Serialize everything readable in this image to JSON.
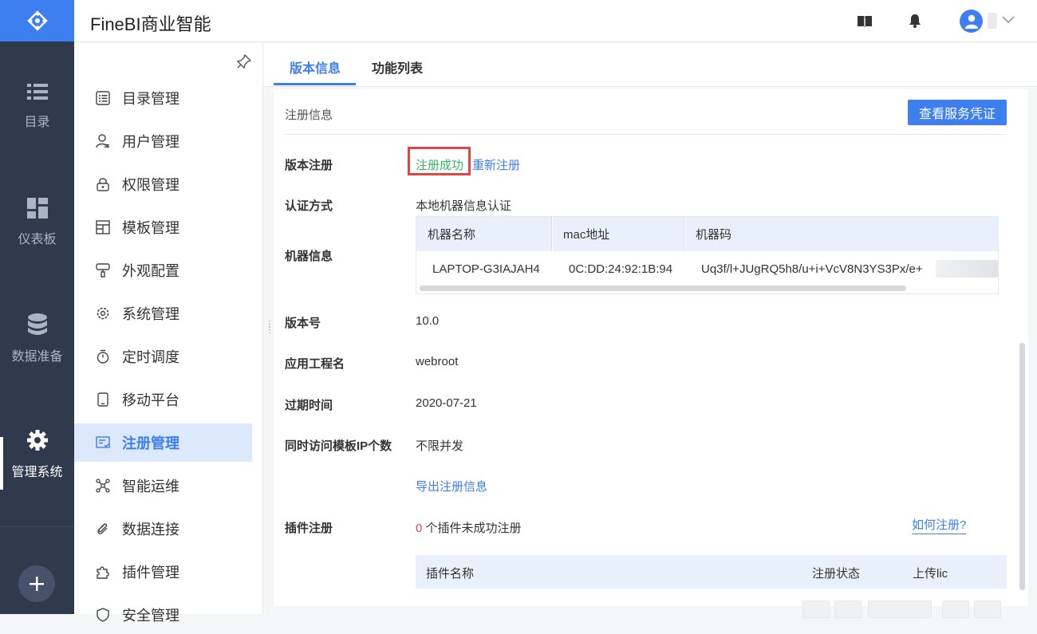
{
  "app": {
    "title": "FineBI商业智能"
  },
  "rail": [
    {
      "label": "目录",
      "icon": "list-icon"
    },
    {
      "label": "仪表板",
      "icon": "dashboard-icon"
    },
    {
      "label": "数据准备",
      "icon": "database-icon"
    },
    {
      "label": "管理系统",
      "icon": "gear-icon",
      "active": true
    }
  ],
  "menu": {
    "items": [
      {
        "label": "目录管理",
        "icon": "catalog-icon"
      },
      {
        "label": "用户管理",
        "icon": "user-icon"
      },
      {
        "label": "权限管理",
        "icon": "lock-icon"
      },
      {
        "label": "模板管理",
        "icon": "template-icon"
      },
      {
        "label": "外观配置",
        "icon": "brush-icon"
      },
      {
        "label": "系统管理",
        "icon": "settings-icon"
      },
      {
        "label": "定时调度",
        "icon": "timer-icon"
      },
      {
        "label": "移动平台",
        "icon": "mobile-icon"
      },
      {
        "label": "注册管理",
        "icon": "register-icon",
        "active": true
      },
      {
        "label": "智能运维",
        "icon": "network-icon"
      },
      {
        "label": "数据连接",
        "icon": "link-icon"
      },
      {
        "label": "插件管理",
        "icon": "puzzle-icon"
      },
      {
        "label": "安全管理",
        "icon": "shield-icon"
      }
    ]
  },
  "tabs": [
    {
      "label": "版本信息",
      "active": true
    },
    {
      "label": "功能列表"
    }
  ],
  "registration": {
    "section_title": "注册信息",
    "view_button": "查看服务凭证",
    "version_reg_label": "版本注册",
    "status": "注册成功",
    "reregister": "重新注册",
    "auth_label": "认证方式",
    "auth_value": "本地机器信息认证",
    "machine_label": "机器信息",
    "machine_table": {
      "headers": [
        "机器名称",
        "mac地址",
        "机器码"
      ],
      "row": [
        "LAPTOP-G3IAJAH4",
        "0C:DD:24:92:1B:94",
        "Uq3f/l+JUgRQ5h8/u+i+VcV8N3YS3Px/e+"
      ]
    },
    "version_label": "版本号",
    "version_value": "10.0",
    "project_label": "应用工程名",
    "project_value": "webroot",
    "expire_label": "过期时间",
    "expire_value": "2020-07-21",
    "concurrency_label": "同时访问模板IP个数",
    "concurrency_value": "不限并发",
    "export_link": "导出注册信息",
    "plugin_label": "插件注册",
    "plugin_fail_count": "0",
    "plugin_fail_text": " 个插件未成功注册",
    "how_link": "如何注册?",
    "plugin_table": {
      "headers": [
        "插件名称",
        "注册状态",
        "上传lic"
      ]
    }
  },
  "colors": {
    "accent": "#3d7ef0",
    "success": "#3bb46a",
    "danger": "#e04545",
    "rail": "#2f3a4d"
  }
}
